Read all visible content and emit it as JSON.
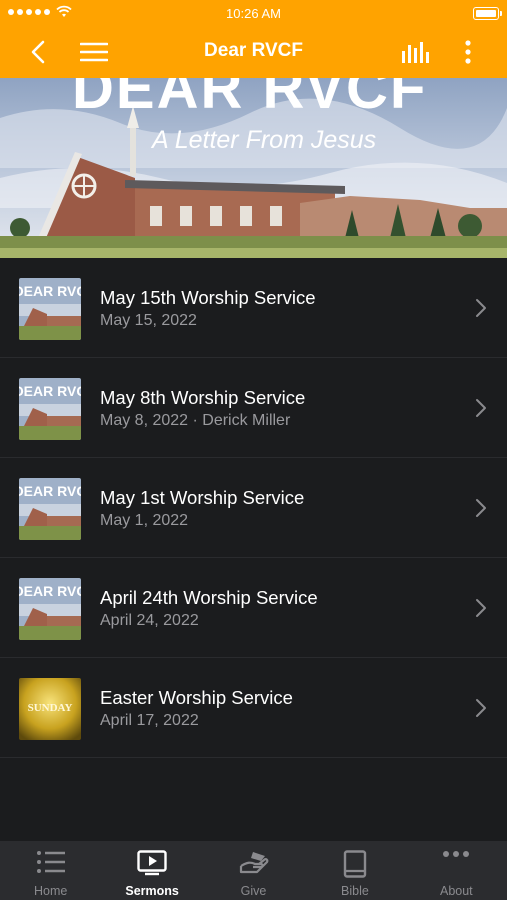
{
  "status_bar": {
    "time": "10:26 AM"
  },
  "nav": {
    "title": "Dear RVCF"
  },
  "hero": {
    "title": "DEAR RVCF",
    "subtitle": "A Letter From Jesus"
  },
  "sermons": [
    {
      "title": "May 15th Worship Service",
      "subtitle": "May 15, 2022",
      "thumb": "DEAR RVC",
      "thumb_style": "dear"
    },
    {
      "title": "May 8th Worship Service",
      "subtitle": "May 8, 2022 · Derick Miller",
      "thumb": "DEAR RVC",
      "thumb_style": "dear"
    },
    {
      "title": "May 1st Worship Service",
      "subtitle": "May 1, 2022",
      "thumb": "DEAR RVC",
      "thumb_style": "dear"
    },
    {
      "title": "April 24th Worship Service",
      "subtitle": "April 24, 2022",
      "thumb": "DEAR RVC",
      "thumb_style": "dear"
    },
    {
      "title": "Easter Worship Service",
      "subtitle": "April 17, 2022",
      "thumb": "SUNDAY",
      "thumb_style": "easter"
    }
  ],
  "tabs": [
    {
      "label": "Home",
      "icon": "list-icon",
      "active": false
    },
    {
      "label": "Sermons",
      "icon": "play-screen-icon",
      "active": true
    },
    {
      "label": "Give",
      "icon": "giving-hand-icon",
      "active": false
    },
    {
      "label": "Bible",
      "icon": "book-icon",
      "active": false
    },
    {
      "label": "About",
      "icon": "more-dots-icon",
      "active": false
    }
  ],
  "colors": {
    "accent": "#ffa300",
    "background": "#1b1c1e",
    "tabbar": "#2b2c2f",
    "subtitle": "#9a9a9e"
  }
}
